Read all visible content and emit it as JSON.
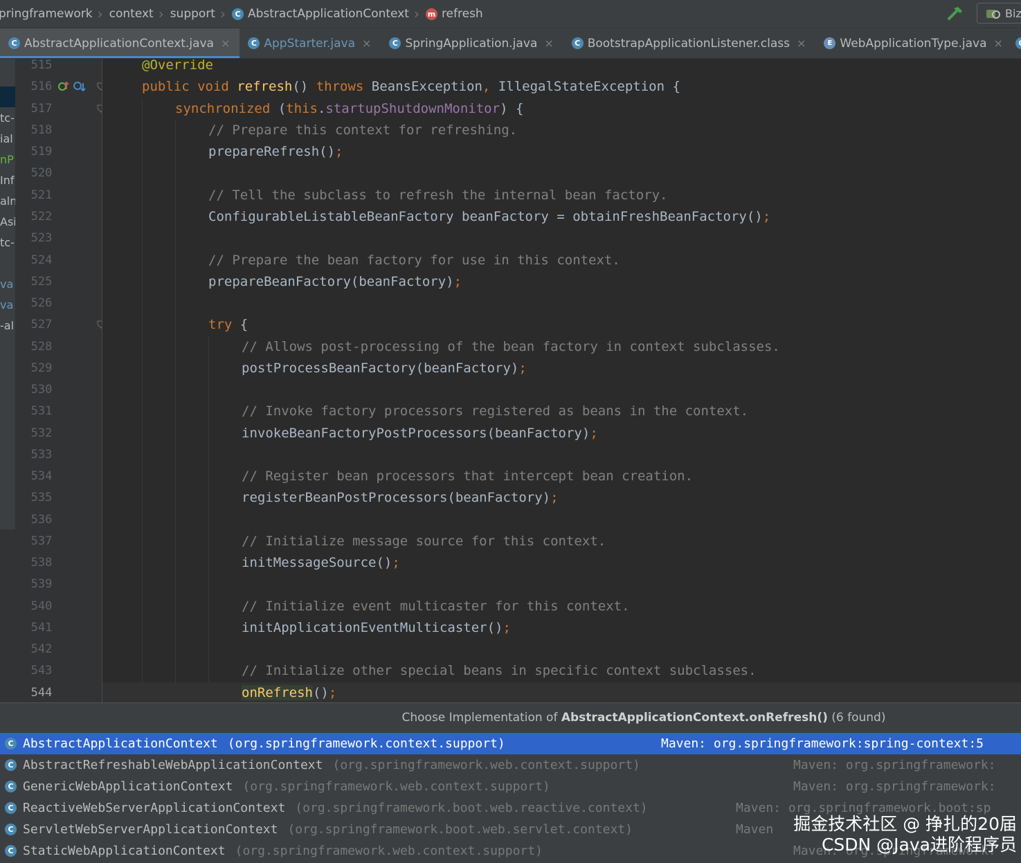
{
  "breadcrumb": {
    "items": [
      "pringframework",
      "context",
      "support",
      "AbstractApplicationContext",
      "refresh"
    ]
  },
  "toolbar": {
    "run_config_label": "Biz",
    "hammer_icon": "hammer-icon"
  },
  "tabs": [
    {
      "label": "AbstractApplicationContext.java",
      "icon": "class-icon",
      "active": true
    },
    {
      "label": "AppStarter.java",
      "icon": "class-icon",
      "active": false
    },
    {
      "label": "SpringApplication.java",
      "icon": "class-icon",
      "active": false
    },
    {
      "label": "BootstrapApplicationListener.class",
      "icon": "class-icon",
      "active": false
    },
    {
      "label": "WebApplicationType.java",
      "icon": "enum-icon",
      "active": false
    }
  ],
  "project_strip": {
    "items": [
      "tc-",
      "ial",
      "nP",
      "Inf",
      "aln",
      "Asi",
      "tc-",
      "va",
      "va",
      "-al"
    ]
  },
  "editor": {
    "line_numbers": [
      "515",
      "516",
      "517",
      "518",
      "519",
      "520",
      "521",
      "522",
      "523",
      "524",
      "525",
      "526",
      "527",
      "528",
      "529",
      "530",
      "531",
      "532",
      "533",
      "534",
      "535",
      "536",
      "537",
      "538",
      "539",
      "540",
      "541",
      "542",
      "543",
      "544"
    ],
    "current_line": "544",
    "code": {
      "l515": "@Override",
      "l516_kw": "public void ",
      "l516_fn": "refresh",
      "l516_a": "() ",
      "l516_kw2": "throws ",
      "l516_b": "BeansException",
      "l516_c": ", ",
      "l516_d": "IllegalStateException {",
      "l517_kw": "synchronized ",
      "l517_a": "(",
      "l517_kw2": "this",
      "l517_b": ".",
      "l517_fld": "startupShutdownMonitor",
      "l517_c": ") {",
      "l518": "// Prepare this context for refreshing.",
      "l519": "prepareRefresh()",
      "l521": "// Tell the subclass to refresh the internal bean factory.",
      "l522": "ConfigurableListableBeanFactory beanFactory = obtainFreshBeanFactory()",
      "l524": "// Prepare the bean factory for use in this context.",
      "l525": "prepareBeanFactory(beanFactory)",
      "l527_kw": "try ",
      "l527_a": "{",
      "l528": "// Allows post-processing of the bean factory in context subclasses.",
      "l529": "postProcessBeanFactory(beanFactory)",
      "l531": "// Invoke factory processors registered as beans in the context.",
      "l532": "invokeBeanFactoryPostProcessors(beanFactory)",
      "l534": "// Register bean processors that intercept bean creation.",
      "l535": "registerBeanPostProcessors(beanFactory)",
      "l537": "// Initialize message source for this context.",
      "l538": "initMessageSource()",
      "l540": "// Initialize event multicaster for this context.",
      "l541": "initApplicationEventMulticaster()",
      "l543": "// Initialize other special beans in specific context subclasses.",
      "l544_fn": "onRefresh",
      "l544_a": "()",
      "semicolon": ";"
    }
  },
  "popup": {
    "title_prefix": "Choose Implementation of ",
    "title_method": "AbstractApplicationContext.onRefresh()",
    "title_suffix": " (6 found)",
    "items": [
      {
        "name": "AbstractApplicationContext",
        "package": "(org.springframework.context.support)",
        "location": "Maven: org.springframework:spring-context:5",
        "selected": true,
        "icon": "abstract-class-icon"
      },
      {
        "name": "AbstractRefreshableWebApplicationContext",
        "package": "(org.springframework.web.context.support)",
        "location": "Maven: org.springframework:",
        "selected": false,
        "icon": "abstract-class-icon"
      },
      {
        "name": "GenericWebApplicationContext",
        "package": "(org.springframework.web.context.support)",
        "location": "Maven: org.springframework:",
        "selected": false,
        "icon": "class-icon"
      },
      {
        "name": "ReactiveWebServerApplicationContext",
        "package": "(org.springframework.boot.web.reactive.context)",
        "location": "Maven: org.springframework.boot:sp",
        "selected": false,
        "icon": "class-icon"
      },
      {
        "name": "ServletWebServerApplicationContext",
        "package": "(org.springframework.boot.web.servlet.context)",
        "location": "Maven",
        "selected": false,
        "icon": "class-icon"
      },
      {
        "name": "StaticWebApplicationContext",
        "package": "(org.springframework.web.context.support)",
        "location": "Maven: org.springframework:",
        "selected": false,
        "icon": "class-icon"
      }
    ]
  },
  "watermark": {
    "line1": "掘金技术社区 @ 挣扎的20届",
    "line2": "CSDN @Java进阶程序员"
  }
}
